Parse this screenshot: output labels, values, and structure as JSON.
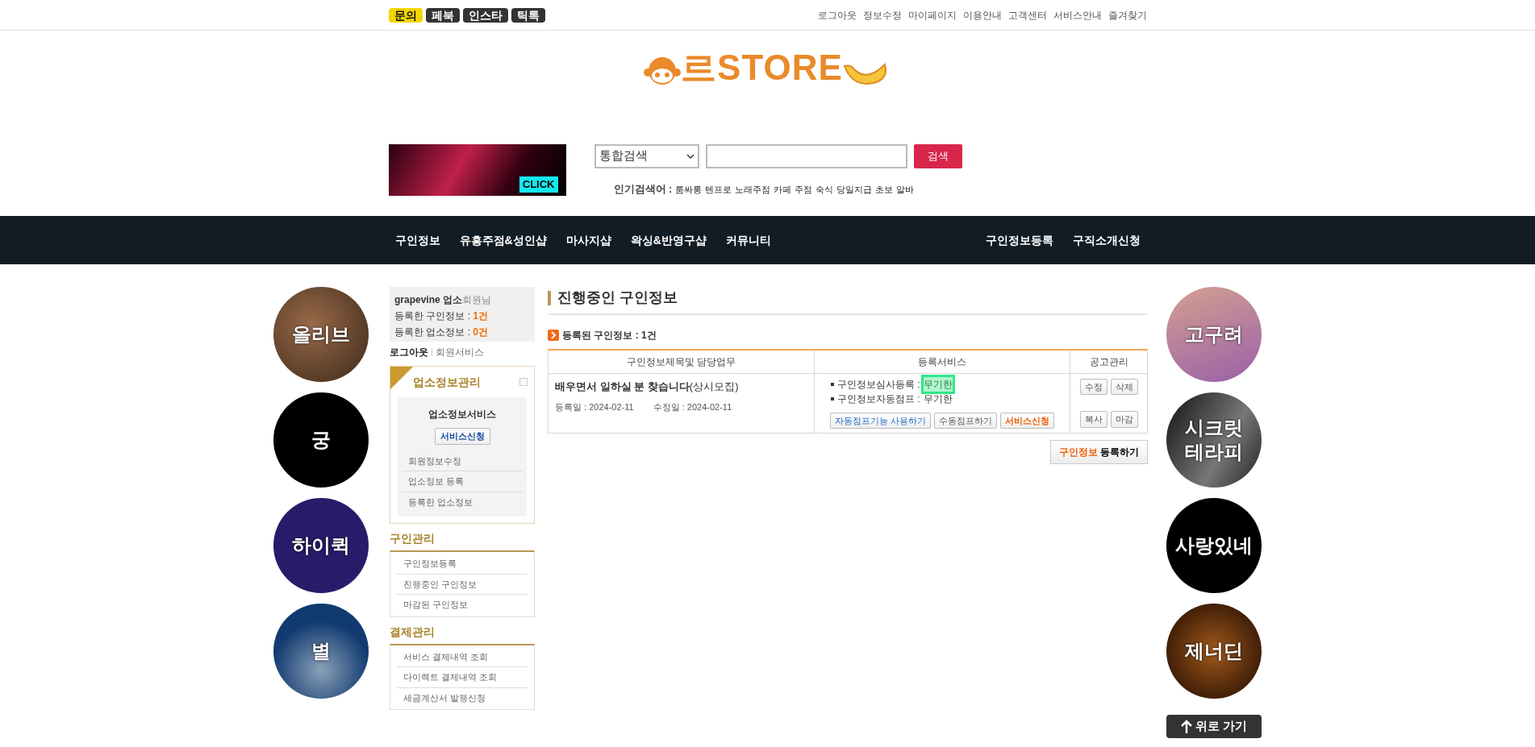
{
  "top_bar": {
    "social_buttons": [
      {
        "label": "문의",
        "kind": "highlight"
      },
      {
        "label": "페북",
        "kind": "dark"
      },
      {
        "label": "인스타",
        "kind": "dark"
      },
      {
        "label": "틱톡",
        "kind": "dark"
      }
    ],
    "links": [
      "로그아웃",
      "정보수정",
      "마이페이지",
      "이용안내",
      "고객센터",
      "서비스안내",
      "즐겨찾기"
    ]
  },
  "logo": {
    "prefix": "르",
    "text": "STORE"
  },
  "banner": {
    "label": "CLICK"
  },
  "search": {
    "category": "통합검색",
    "button": "검색"
  },
  "popular": {
    "label": "인기검색어 :",
    "terms": [
      "룸싸롱",
      "텐프로",
      "노래주점",
      "카페",
      "주점",
      "숙식",
      "당일지급",
      "초보",
      "알바"
    ]
  },
  "nav": {
    "items": [
      "구인정보",
      "유흥주점&성인샵",
      "마사지샵",
      "왁싱&반영구샵",
      "커뮤니티"
    ],
    "right_items": [
      "구인정보등록",
      "구직소개신청"
    ]
  },
  "left_banners": [
    {
      "lines": [
        "올리브"
      ]
    },
    {
      "lines": [
        "궁"
      ]
    },
    {
      "lines": [
        "하이퀵"
      ]
    },
    {
      "lines": [
        "별"
      ]
    }
  ],
  "right_banners": [
    {
      "lines": [
        "고구려"
      ]
    },
    {
      "lines": [
        "시크릿",
        "테라피"
      ]
    },
    {
      "lines": [
        "사랑있네"
      ]
    },
    {
      "lines": [
        "제너딘"
      ]
    }
  ],
  "back_to_top": "위로 가기",
  "sidebar": {
    "member": {
      "name": "grapevine",
      "type": "업소",
      "suffix": "회원님"
    },
    "stats": [
      {
        "label": "등록한 구인정보 :",
        "value": "1건"
      },
      {
        "label": "등록한 업소정보 :",
        "value": "0건"
      }
    ],
    "links": [
      "로그아웃",
      "회원서비스"
    ],
    "biz_panel": {
      "title": "업소정보관리",
      "subtitle": "업소정보서비스",
      "button": "서비스신청",
      "items": [
        "회원정보수정",
        "업소정보 등록",
        "등록한 업소정보"
      ]
    },
    "sections": [
      {
        "title": "구인관리",
        "items": [
          "구인정보등록",
          "진행중인 구인정보",
          "마감된 구인정보"
        ]
      },
      {
        "title": "결제관리",
        "items": [
          "서비스 결제내역 조회",
          "다이렉트 결제내역 조회",
          "세금계산서 발행신청"
        ]
      }
    ]
  },
  "main": {
    "title": "진행중인 구인정보",
    "count_label": "등록된 구인정보 : 1건",
    "table": {
      "columns": [
        "구인정보제목및 담당업무",
        "등록서비스",
        "공고관리"
      ],
      "rows": [
        {
          "title": "배우면서 일하실 분 찾습니다",
          "note": "(상시모집)",
          "registered": "등록일 : 2024-02-11",
          "modified": "수정일 : 2024-02-11",
          "services": [
            {
              "label": "구인정보심사등록 :",
              "value": "무기한",
              "highlighted": true
            },
            {
              "label": "구인정보자동점프 :",
              "value": "무기한",
              "highlighted": false
            }
          ],
          "service_buttons": [
            {
              "label": "자동점프기능 사용하기",
              "kind": "blue"
            },
            {
              "label": "수동점프하기",
              "kind": "plain"
            },
            {
              "label": "서비스신청",
              "kind": "orange"
            }
          ],
          "actions": [
            [
              "수정",
              "삭제"
            ],
            [
              "복사",
              "마감"
            ]
          ]
        }
      ]
    },
    "register_button": {
      "accent": "구인정보",
      "label": "등록하기"
    }
  }
}
